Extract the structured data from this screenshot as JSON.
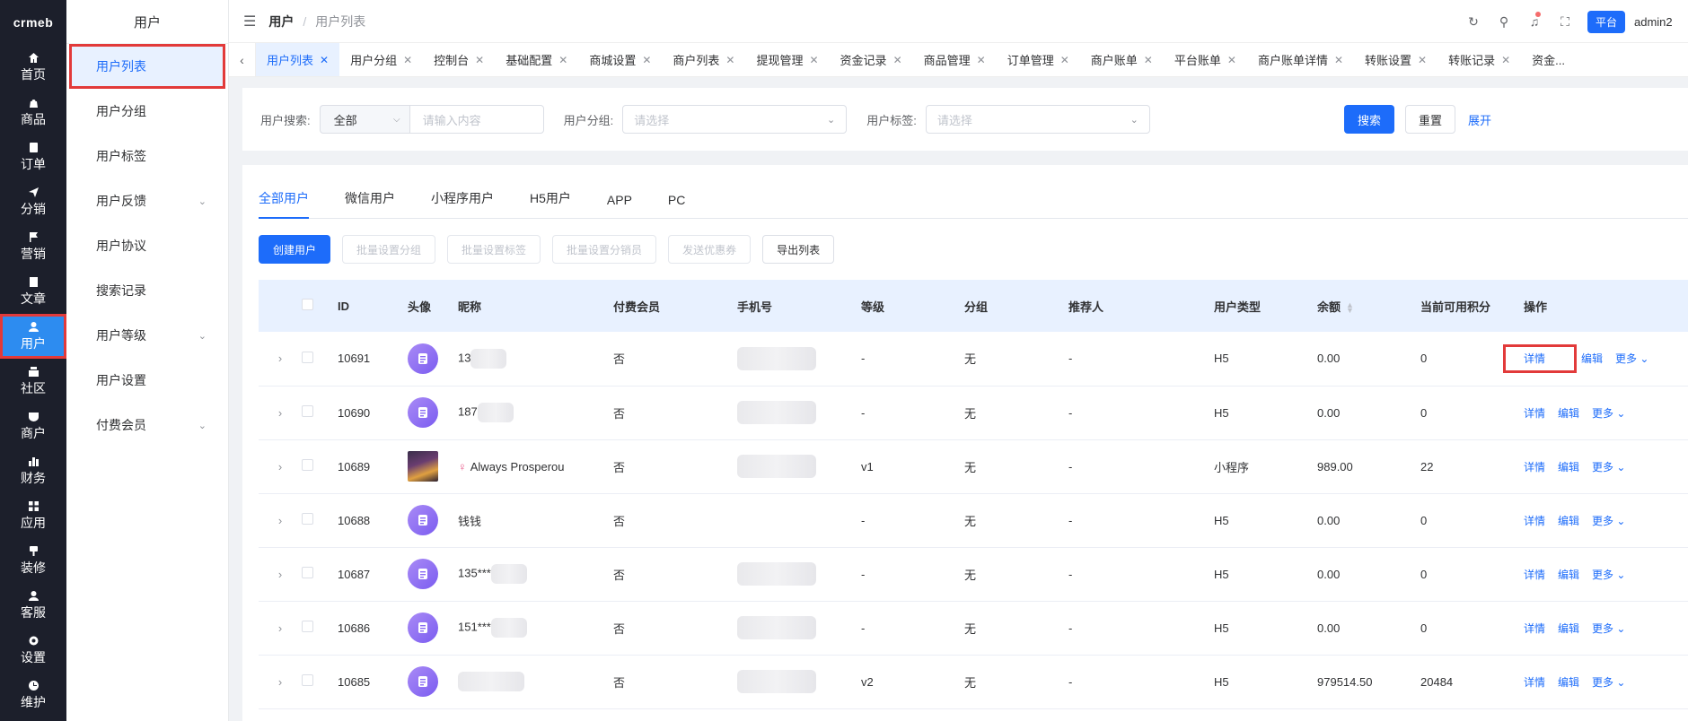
{
  "sidebar": {
    "logo": "crmeb",
    "items": [
      {
        "label": "首页",
        "icon": "home-icon"
      },
      {
        "label": "商品",
        "icon": "bag-icon"
      },
      {
        "label": "订单",
        "icon": "order-icon"
      },
      {
        "label": "分销",
        "icon": "send-icon"
      },
      {
        "label": "营销",
        "icon": "flag-icon"
      },
      {
        "label": "文章",
        "icon": "book-icon"
      },
      {
        "label": "用户",
        "icon": "user-icon"
      },
      {
        "label": "社区",
        "icon": "community-icon"
      },
      {
        "label": "商户",
        "icon": "shop-icon"
      },
      {
        "label": "财务",
        "icon": "finance-icon"
      },
      {
        "label": "应用",
        "icon": "apps-icon"
      },
      {
        "label": "装修",
        "icon": "decorate-icon"
      },
      {
        "label": "客服",
        "icon": "service-icon"
      },
      {
        "label": "设置",
        "icon": "settings-icon"
      },
      {
        "label": "维护",
        "icon": "maintenance-icon"
      }
    ]
  },
  "submenu": {
    "title": "用户",
    "items": [
      {
        "label": "用户列表",
        "has_children": false
      },
      {
        "label": "用户分组",
        "has_children": false
      },
      {
        "label": "用户标签",
        "has_children": false
      },
      {
        "label": "用户反馈",
        "has_children": true
      },
      {
        "label": "用户协议",
        "has_children": false
      },
      {
        "label": "搜索记录",
        "has_children": false
      },
      {
        "label": "用户等级",
        "has_children": true
      },
      {
        "label": "用户设置",
        "has_children": false
      },
      {
        "label": "付费会员",
        "has_children": true
      }
    ]
  },
  "header": {
    "breadcrumb_1": "用户",
    "breadcrumb_sep": "/",
    "breadcrumb_2": "用户列表",
    "platform_badge": "平台",
    "username": "admin2"
  },
  "tabs": [
    {
      "label": "用户列表"
    },
    {
      "label": "用户分组"
    },
    {
      "label": "控制台"
    },
    {
      "label": "基础配置"
    },
    {
      "label": "商城设置"
    },
    {
      "label": "商户列表"
    },
    {
      "label": "提现管理"
    },
    {
      "label": "资金记录"
    },
    {
      "label": "商品管理"
    },
    {
      "label": "订单管理"
    },
    {
      "label": "商户账单"
    },
    {
      "label": "平台账单"
    },
    {
      "label": "商户账单详情"
    },
    {
      "label": "转账设置"
    },
    {
      "label": "转账记录"
    },
    {
      "label": "资金..."
    }
  ],
  "filter": {
    "search_label": "用户搜索:",
    "search_type": "全部",
    "search_placeholder": "请输入内容",
    "group_label": "用户分组:",
    "group_placeholder": "请选择",
    "tag_label": "用户标签:",
    "tag_placeholder": "请选择",
    "search_button": "搜索",
    "reset_button": "重置",
    "expand_link": "展开"
  },
  "user_tabs": [
    "全部用户",
    "微信用户",
    "小程序用户",
    "H5用户",
    "APP",
    "PC"
  ],
  "actions": {
    "create": "创建用户",
    "batch_group": "批量设置分组",
    "batch_tag": "批量设置标签",
    "batch_distributor": "批量设置分销员",
    "send_coupon": "发送优惠券",
    "export": "导出列表"
  },
  "table": {
    "columns": [
      "ID",
      "头像",
      "昵称",
      "付费会员",
      "手机号",
      "等级",
      "分组",
      "推荐人",
      "用户类型",
      "余额",
      "当前可用积分",
      "操作"
    ],
    "op_detail": "详情",
    "op_edit": "编辑",
    "op_more": "更多",
    "rows": [
      {
        "id": "10691",
        "nickname": "13",
        "nick_blur": true,
        "avatar": "default",
        "paid": "否",
        "phone_blur": true,
        "level": "-",
        "group": "无",
        "referrer": "-",
        "type": "H5",
        "balance": "0.00",
        "points": "0"
      },
      {
        "id": "10690",
        "nickname": "187",
        "nick_blur": true,
        "avatar": "default",
        "paid": "否",
        "phone_blur": true,
        "level": "-",
        "group": "无",
        "referrer": "-",
        "type": "H5",
        "balance": "0.00",
        "points": "0"
      },
      {
        "id": "10689",
        "nickname": "Always Prosperou",
        "nick_blur": false,
        "avatar": "photo",
        "female": true,
        "paid": "否",
        "phone_blur": true,
        "level": "v1",
        "group": "无",
        "referrer": "-",
        "type": "小程序",
        "balance": "989.00",
        "points": "22"
      },
      {
        "id": "10688",
        "nickname": "钱钱",
        "nick_blur": false,
        "avatar": "default",
        "paid": "否",
        "phone_blur": false,
        "level": "-",
        "group": "无",
        "referrer": "-",
        "type": "H5",
        "balance": "0.00",
        "points": "0"
      },
      {
        "id": "10687",
        "nickname": "135***",
        "nick_blur": true,
        "avatar": "default",
        "paid": "否",
        "phone_blur": true,
        "level": "-",
        "group": "无",
        "referrer": "-",
        "type": "H5",
        "balance": "0.00",
        "points": "0"
      },
      {
        "id": "10686",
        "nickname": "151***",
        "nick_blur": true,
        "avatar": "default",
        "paid": "否",
        "phone_blur": true,
        "level": "-",
        "group": "无",
        "referrer": "-",
        "type": "H5",
        "balance": "0.00",
        "points": "0"
      },
      {
        "id": "10685",
        "nickname": "",
        "nick_blur": true,
        "avatar": "default",
        "paid": "否",
        "phone_blur": true,
        "level": "v2",
        "group": "无",
        "referrer": "-",
        "type": "H5",
        "balance": "979514.50",
        "points": "20484"
      }
    ]
  },
  "colors": {
    "accent": "#1d6cfa",
    "sidebar_bg": "#1c1f2b",
    "highlight": "#e23a3a"
  }
}
